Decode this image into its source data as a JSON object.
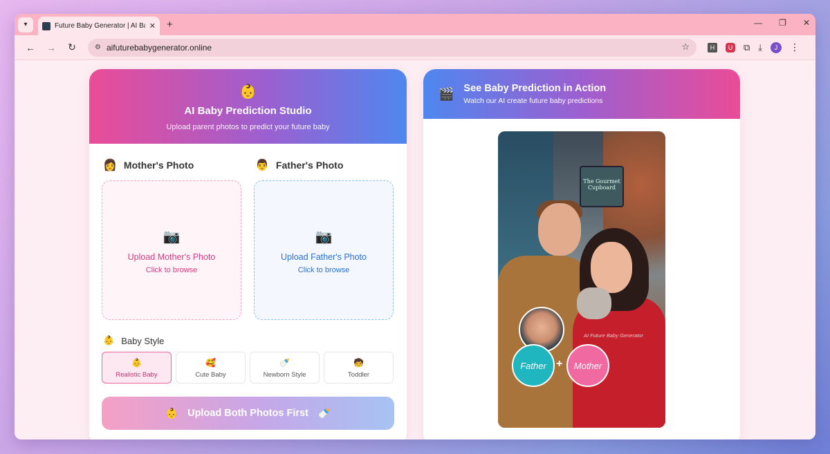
{
  "browser": {
    "tab_title": "Future Baby Generator | AI Baby Prediction",
    "url": "aifuturebabygenerator.online",
    "avatar_letter": "J",
    "ext_h": "H",
    "ext_u": "U"
  },
  "studio": {
    "icon": "👶",
    "title": "AI Baby Prediction Studio",
    "subtitle": "Upload parent photos to predict your future baby",
    "mother": {
      "label": "Mother's Photo",
      "icon": "👩",
      "upload_title": "Upload Mother's Photo",
      "upload_sub": "Click to browse"
    },
    "father": {
      "label": "Father's Photo",
      "icon": "👨",
      "upload_title": "Upload Father's Photo",
      "upload_sub": "Click to browse"
    },
    "style_label": "Baby Style",
    "style_icon": "👶",
    "styles": [
      {
        "emoji": "👶",
        "name": "Realistic Baby",
        "selected": true
      },
      {
        "emoji": "🥰",
        "name": "Cute Baby",
        "selected": false
      },
      {
        "emoji": "🍼",
        "name": "Newborn Style",
        "selected": false
      },
      {
        "emoji": "🧒",
        "name": "Toddler",
        "selected": false
      }
    ],
    "submit_label": "Upload Both Photos First",
    "submit_left_icon": "👶",
    "submit_right_icon": "🍼"
  },
  "demo": {
    "icon": "🎬",
    "title": "See Baby Prediction in Action",
    "subtitle": "Watch our AI create future baby predictions",
    "sign_text": "The Gourmet Cupboard",
    "watermark": "AI Future Baby Generator",
    "father_label": "Father",
    "mother_label": "Mother",
    "plus": "+"
  }
}
